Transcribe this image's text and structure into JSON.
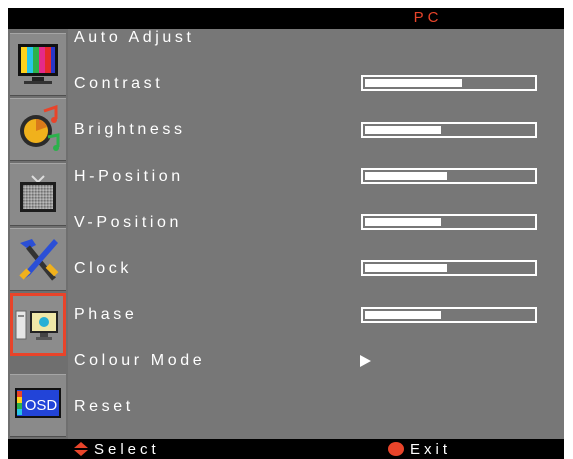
{
  "osd": {
    "title": "PC",
    "menu_items": [
      {
        "label": "Auto Adjust"
      },
      {
        "label": "Contrast",
        "level": 0.58
      },
      {
        "label": "Brightness",
        "level": 0.45
      },
      {
        "label": "H-Position",
        "level": 0.49
      },
      {
        "label": "V-Position",
        "level": 0.45
      },
      {
        "label": "Clock",
        "level": 0.49
      },
      {
        "label": "Phase",
        "level": 0.45
      },
      {
        "label": "Colour Mode",
        "has_submenu": true
      },
      {
        "label": "Reset"
      }
    ],
    "sidebar_icons": [
      {
        "name": "color-bars-icon"
      },
      {
        "name": "speaker-note-icon"
      },
      {
        "name": "tv-screen-icon"
      },
      {
        "name": "tools-icon"
      },
      {
        "name": "pc-monitor-icon",
        "active": true
      },
      {
        "name": "osd-icon",
        "text": "OSD"
      }
    ],
    "footer": {
      "select_label": "Select",
      "exit_label": "Exit"
    },
    "colors": {
      "accent": "#e8442a",
      "background": "#777777",
      "bar": "#000000",
      "text": "#ffffff"
    }
  }
}
